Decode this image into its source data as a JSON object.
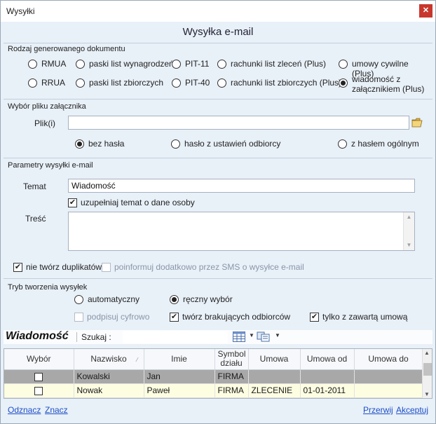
{
  "window": {
    "title": "Wysyłki"
  },
  "heading": "Wysyłka e-mail",
  "doc_type": {
    "group_label": "Rodzaj generowanego dokumentu",
    "options": [
      {
        "label": "RMUA",
        "selected": false
      },
      {
        "label": "paski list wynagrodzeń",
        "selected": false
      },
      {
        "label": "PIT-11",
        "selected": false
      },
      {
        "label": "rachunki list zleceń (Plus)",
        "selected": false
      },
      {
        "label": "umowy cywilne (Plus)",
        "selected": false
      },
      {
        "label": "RRUA",
        "selected": false
      },
      {
        "label": "paski list zbiorczych",
        "selected": false
      },
      {
        "label": "PIT-40",
        "selected": false
      },
      {
        "label": "rachunki list zbiorczych (Plus)",
        "selected": false
      },
      {
        "label": "wiadomość z załącznikiem (Plus)",
        "selected": true
      }
    ]
  },
  "attachment": {
    "group_label": "Wybór pliku załącznika",
    "file_label": "Plik(i)",
    "file_value": "",
    "password_options": [
      {
        "label": "bez hasła",
        "selected": true
      },
      {
        "label": "hasło z ustawień odbiorcy",
        "selected": false
      },
      {
        "label": "z hasłem ogólnym",
        "selected": false
      }
    ]
  },
  "email_params": {
    "group_label": "Parametry wysyłki e-mail",
    "subject_label": "Temat",
    "subject_value": "Wiadomość",
    "fill_subject": {
      "label": "uzupełniaj temat o dane osoby",
      "checked": true
    },
    "body_label": "Treść",
    "no_duplicates": {
      "label": "nie twórz duplikatów",
      "checked": true
    },
    "sms_notify": {
      "label": "poinformuj dodatkowo przez SMS o wysyłce e-mail",
      "checked": false
    }
  },
  "creation_mode": {
    "group_label": "Tryb tworzenia wysyłek",
    "options": [
      {
        "label": "automatyczny",
        "selected": false
      },
      {
        "label": "ręczny wybór",
        "selected": true
      }
    ],
    "sign_digitally": {
      "label": "podpisuj cyfrowo",
      "checked": false
    },
    "create_missing": {
      "label": "twórz brakujących odbiorców",
      "checked": true
    },
    "only_with_contract": {
      "label": "tylko z zawartą umową",
      "checked": true
    }
  },
  "toolbar": {
    "title": "Wiadomość",
    "search_label": "Szukaj :"
  },
  "grid": {
    "columns": [
      "Wybór",
      "Nazwisko",
      "Imie",
      "Symbol działu",
      "Umowa",
      "Umowa od",
      "Umowa do"
    ],
    "rows": [
      {
        "checked": false,
        "nazwisko": "Kowalski",
        "imie": "Jan",
        "symbol": "FIRMA",
        "umowa": "",
        "od": "",
        "do": ""
      },
      {
        "checked": false,
        "nazwisko": "Nowak",
        "imie": "Paweł",
        "symbol": "FIRMA",
        "umowa": "ZLECENIE",
        "od": "01-01-2011",
        "do": ""
      }
    ]
  },
  "footer": {
    "deselect": "Odznacz",
    "select": "Znacz",
    "abort": "Przerwij",
    "accept": "Akceptuj"
  },
  "colors": {
    "link": "#1d4fc7",
    "window_bg": "#e8f0f8",
    "close": "#c8372d",
    "row_selected": "#a8a8a8",
    "row_alt": "#fdfde2"
  }
}
